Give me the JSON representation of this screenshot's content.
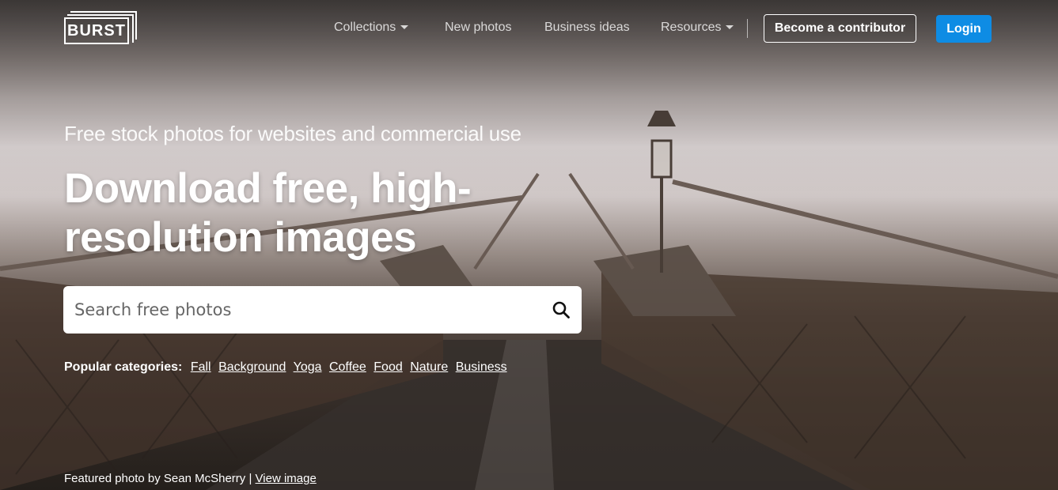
{
  "header": {
    "logo_text": "BURST",
    "nav": {
      "collections": "Collections",
      "new_photos": "New photos",
      "business_ideas": "Business ideas",
      "resources": "Resources"
    },
    "contributor_button": "Become a contributor",
    "login_button": "Login"
  },
  "hero": {
    "subheadline": "Free stock photos for websites and commercial use",
    "headline": "Download free, high-resolution images",
    "search": {
      "placeholder": "Search free photos"
    },
    "popular_label": "Popular categories:",
    "categories": [
      "Fall",
      "Background",
      "Yoga",
      "Coffee",
      "Food",
      "Nature",
      "Business"
    ],
    "credit_text": "Featured photo by Sean McSherry |",
    "credit_link": "View image"
  },
  "colors": {
    "login_bg": "#0e8ce4"
  },
  "icons": [
    "search-icon",
    "chevron-down-icon"
  ]
}
